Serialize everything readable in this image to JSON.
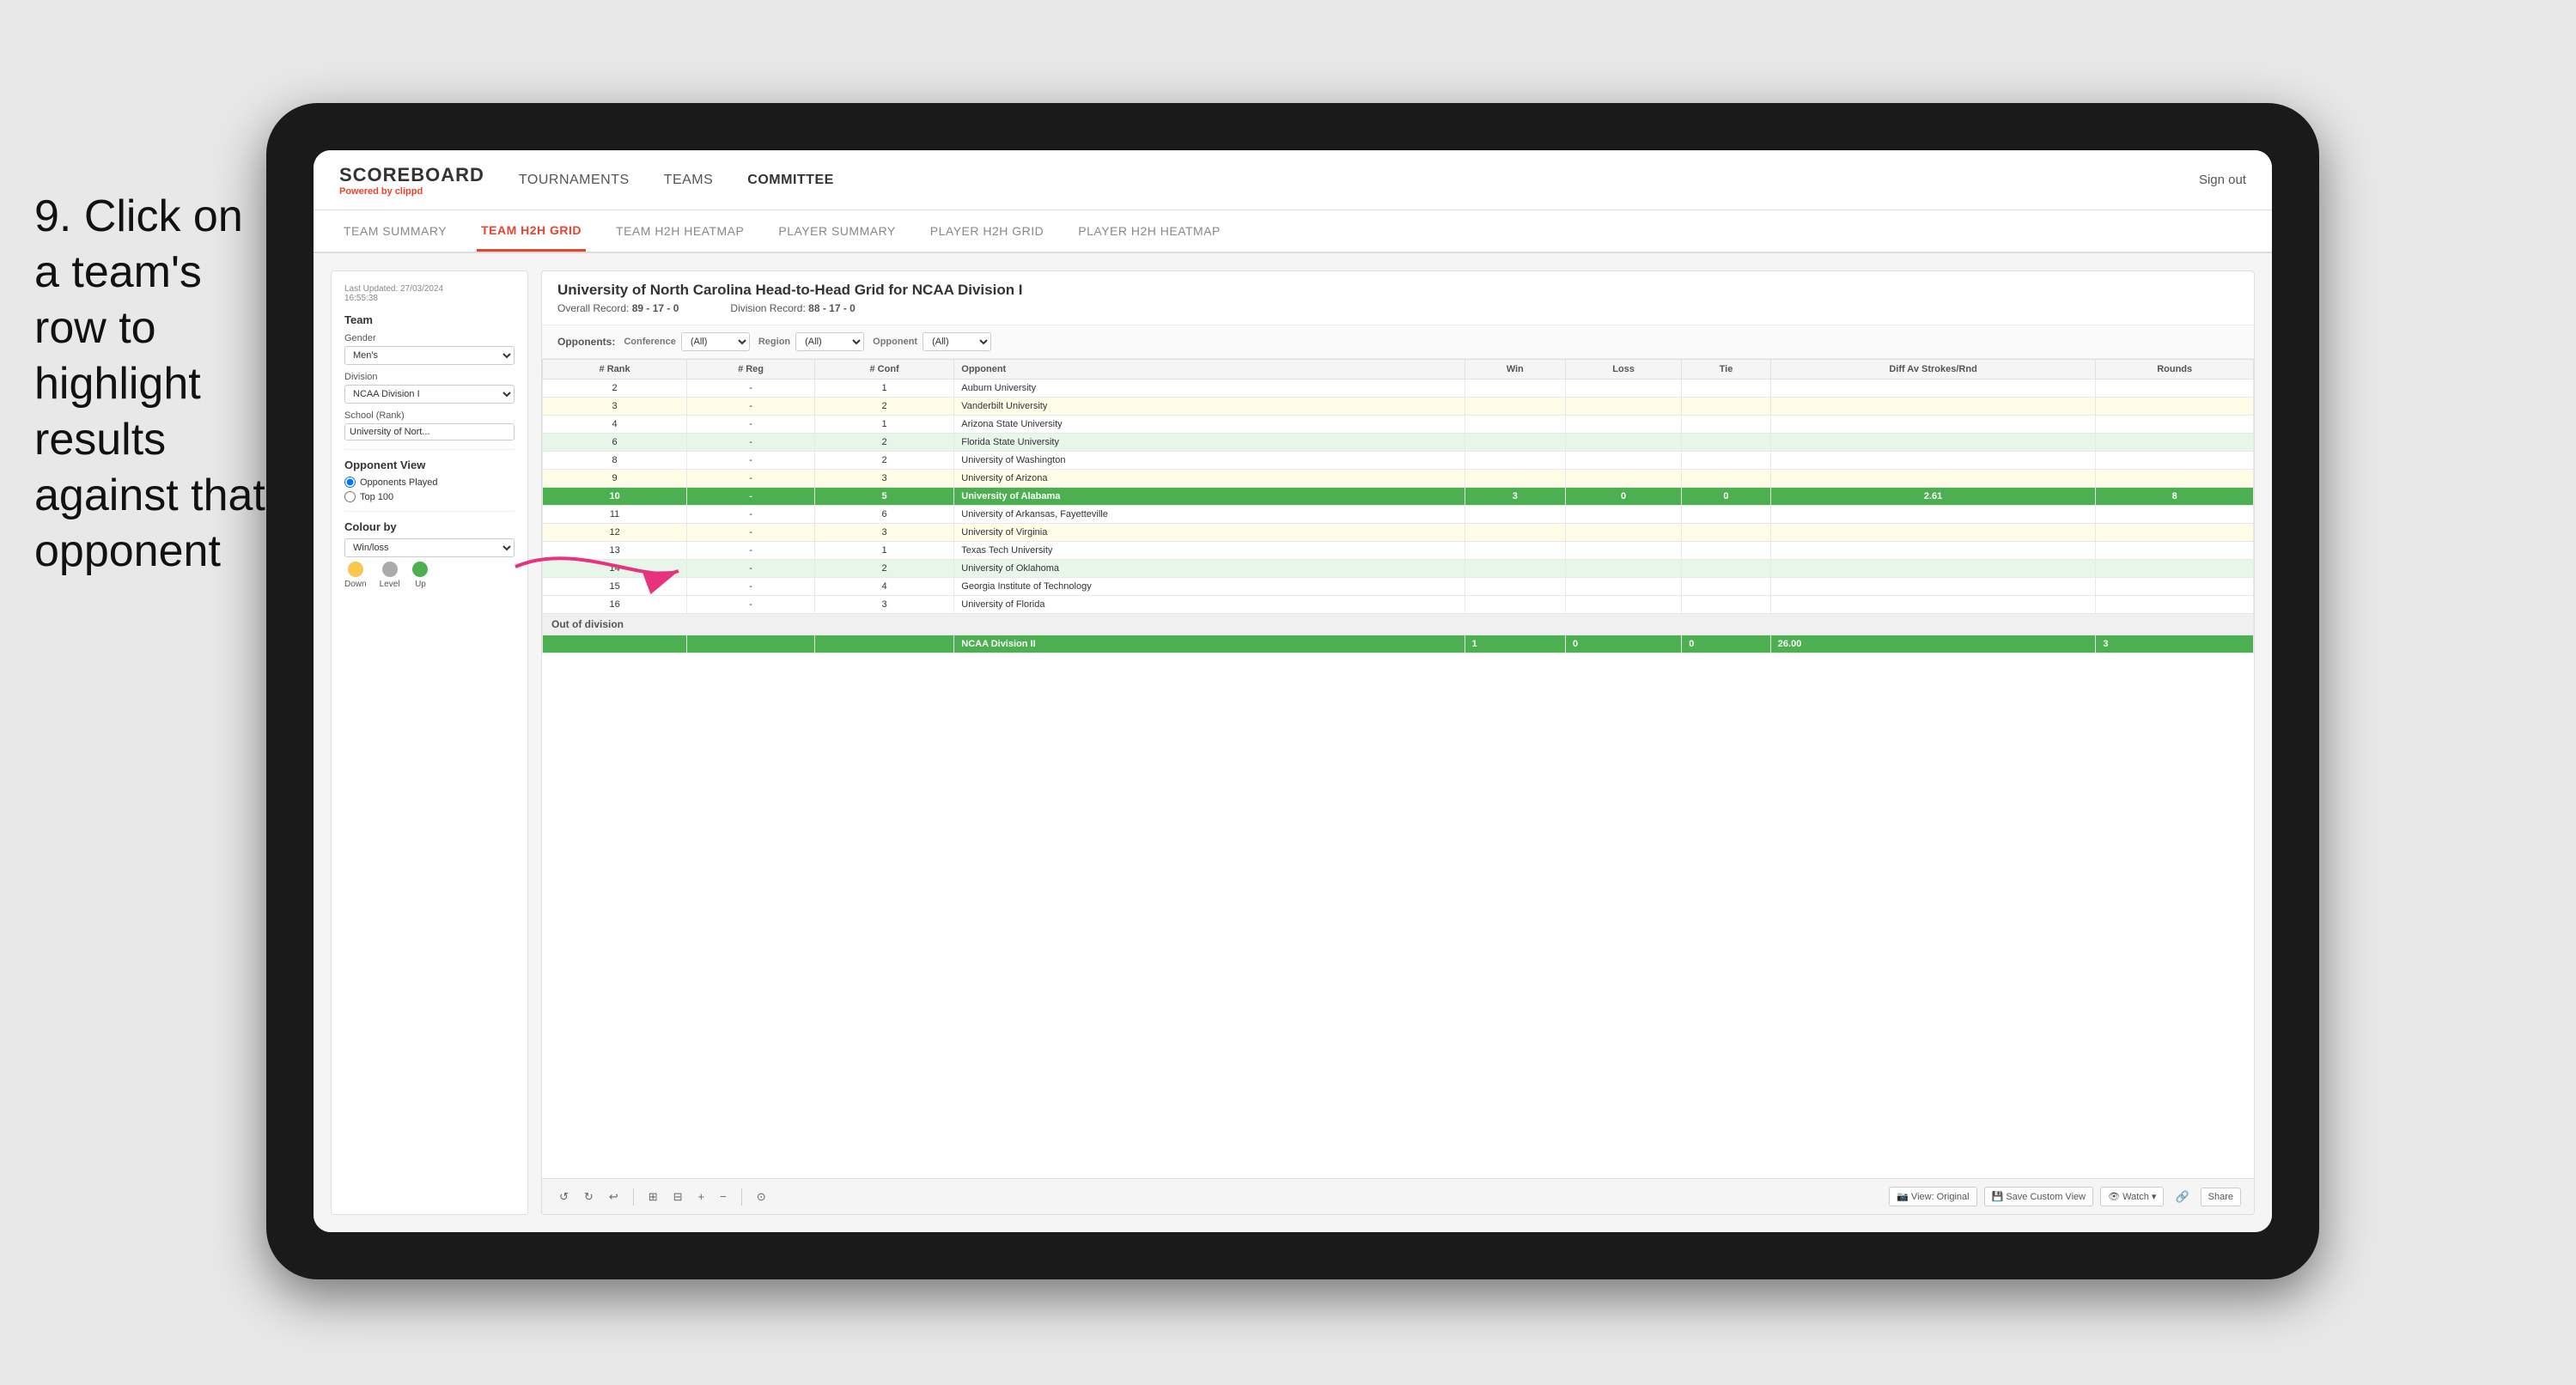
{
  "instruction": {
    "step": "9.",
    "text": "Click on a team's row to highlight results against that opponent"
  },
  "nav": {
    "logo": "SCOREBOARD",
    "powered_by": "Powered by",
    "brand": "clippd",
    "links": [
      "TOURNAMENTS",
      "TEAMS",
      "COMMITTEE"
    ],
    "sign_out": "Sign out"
  },
  "sub_nav": {
    "links": [
      "TEAM SUMMARY",
      "TEAM H2H GRID",
      "TEAM H2H HEATMAP",
      "PLAYER SUMMARY",
      "PLAYER H2H GRID",
      "PLAYER H2H HEATMAP"
    ],
    "active": "TEAM H2H GRID"
  },
  "sidebar": {
    "last_updated": "Last Updated: 27/03/2024",
    "time": "16:55:38",
    "team_label": "Team",
    "gender_label": "Gender",
    "gender_value": "Men's",
    "division_label": "Division",
    "division_value": "NCAA Division I",
    "school_label": "School (Rank)",
    "school_value": "University of Nort...",
    "opponent_view_label": "Opponent View",
    "opponents_played": "Opponents Played",
    "top100": "Top 100",
    "colour_by_label": "Colour by",
    "colour_by_value": "Win/loss",
    "legend": [
      {
        "label": "Down",
        "color": "#f9c74f"
      },
      {
        "label": "Level",
        "color": "#aaaaaa"
      },
      {
        "label": "Up",
        "color": "#4caf50"
      }
    ]
  },
  "data_panel": {
    "title": "University of North Carolina Head-to-Head Grid for NCAA Division I",
    "overall_record_label": "Overall Record:",
    "overall_record": "89 - 17 - 0",
    "division_record_label": "Division Record:",
    "division_record": "88 - 17 - 0",
    "filter": {
      "opponents_label": "Opponents:",
      "conference_label": "Conference",
      "conference_value": "(All)",
      "region_label": "Region",
      "region_value": "(All)",
      "opponent_label": "Opponent",
      "opponent_value": "(All)"
    },
    "table_headers": [
      "# Rank",
      "# Reg",
      "# Conf",
      "Opponent",
      "Win",
      "Loss",
      "Tie",
      "Diff Av Strokes/Rnd",
      "Rounds"
    ],
    "rows": [
      {
        "rank": "2",
        "reg": "-",
        "conf": "1",
        "opponent": "Auburn University",
        "win": "",
        "loss": "",
        "tie": "",
        "diff": "",
        "rounds": "",
        "highlight": false,
        "bg": ""
      },
      {
        "rank": "3",
        "reg": "-",
        "conf": "2",
        "opponent": "Vanderbilt University",
        "win": "",
        "loss": "",
        "tie": "",
        "diff": "",
        "rounds": "",
        "highlight": false,
        "bg": "light-yellow"
      },
      {
        "rank": "4",
        "reg": "-",
        "conf": "1",
        "opponent": "Arizona State University",
        "win": "",
        "loss": "",
        "tie": "",
        "diff": "",
        "rounds": "",
        "highlight": false,
        "bg": ""
      },
      {
        "rank": "6",
        "reg": "-",
        "conf": "2",
        "opponent": "Florida State University",
        "win": "",
        "loss": "",
        "tie": "",
        "diff": "",
        "rounds": "",
        "highlight": false,
        "bg": "light-green"
      },
      {
        "rank": "8",
        "reg": "-",
        "conf": "2",
        "opponent": "University of Washington",
        "win": "",
        "loss": "",
        "tie": "",
        "diff": "",
        "rounds": "",
        "highlight": false,
        "bg": ""
      },
      {
        "rank": "9",
        "reg": "-",
        "conf": "3",
        "opponent": "University of Arizona",
        "win": "",
        "loss": "",
        "tie": "",
        "diff": "",
        "rounds": "",
        "highlight": false,
        "bg": "light-yellow"
      },
      {
        "rank": "10",
        "reg": "-",
        "conf": "5",
        "opponent": "University of Alabama",
        "win": "3",
        "loss": "0",
        "tie": "0",
        "diff": "2.61",
        "rounds": "8",
        "highlight": true,
        "bg": "green"
      },
      {
        "rank": "11",
        "reg": "-",
        "conf": "6",
        "opponent": "University of Arkansas, Fayetteville",
        "win": "",
        "loss": "",
        "tie": "",
        "diff": "",
        "rounds": "",
        "highlight": false,
        "bg": ""
      },
      {
        "rank": "12",
        "reg": "-",
        "conf": "3",
        "opponent": "University of Virginia",
        "win": "",
        "loss": "",
        "tie": "",
        "diff": "",
        "rounds": "",
        "highlight": false,
        "bg": "light-yellow"
      },
      {
        "rank": "13",
        "reg": "-",
        "conf": "1",
        "opponent": "Texas Tech University",
        "win": "",
        "loss": "",
        "tie": "",
        "diff": "",
        "rounds": "",
        "highlight": false,
        "bg": ""
      },
      {
        "rank": "14",
        "reg": "-",
        "conf": "2",
        "opponent": "University of Oklahoma",
        "win": "",
        "loss": "",
        "tie": "",
        "diff": "",
        "rounds": "",
        "highlight": false,
        "bg": "light-green"
      },
      {
        "rank": "15",
        "reg": "-",
        "conf": "4",
        "opponent": "Georgia Institute of Technology",
        "win": "",
        "loss": "",
        "tie": "",
        "diff": "",
        "rounds": "",
        "highlight": false,
        "bg": ""
      },
      {
        "rank": "16",
        "reg": "-",
        "conf": "3",
        "opponent": "University of Florida",
        "win": "",
        "loss": "",
        "tie": "",
        "diff": "",
        "rounds": "",
        "highlight": false,
        "bg": ""
      }
    ],
    "out_of_division_label": "Out of division",
    "out_of_division_row": {
      "label": "NCAA Division II",
      "win": "1",
      "loss": "0",
      "tie": "0",
      "diff": "26.00",
      "rounds": "3"
    }
  },
  "toolbar": {
    "buttons": [
      "View: Original",
      "Save Custom View",
      "Watch ▾",
      "Share"
    ],
    "icons": [
      "↺",
      "↻",
      "↩",
      "⊞",
      "⊟",
      "+",
      "−",
      "⊙"
    ]
  }
}
